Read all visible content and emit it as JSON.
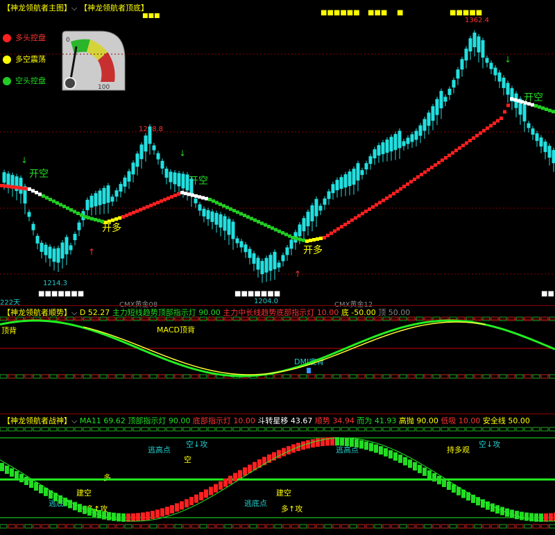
{
  "panel1": {
    "tabs": [
      "【神龙领航者主图】",
      "【神龙领航者顶底】"
    ],
    "top_tags": [
      "■■■■■■",
      "■■■",
      "■",
      "■■■■■"
    ],
    "legend": [
      {
        "label": "多头控盘",
        "color": "#ff2020"
      },
      {
        "label": "多空震荡",
        "color": "#ffff00"
      },
      {
        "label": "空头控盘",
        "color": "#22cc22"
      }
    ],
    "gauge": {
      "min": "0",
      "max": "100",
      "level": 0.12
    },
    "price_labels": {
      "high1": "1298.8",
      "high2": "1362.4",
      "low1": "1214.3",
      "low2": "1204.0"
    },
    "signals": {
      "open_short": "开空",
      "open_long": "开多"
    },
    "bottom_tags": [
      "■■■■■■■",
      "■■■■■■■",
      "■■"
    ],
    "footer": {
      "days": "222天",
      "contract1": "CMX黄金08",
      "contract2": "CMX黄金12"
    }
  },
  "panel2": {
    "title": "【神龙领航者顺势】",
    "indicators": [
      {
        "text": "D 52.27",
        "color": "#ffff00"
      },
      {
        "text": "主力短线趋势顶部指示灯 90.00",
        "color": "#22dd22"
      },
      {
        "text": "主力中长线趋势底部指示灯 10.00",
        "color": "#ff3333"
      },
      {
        "text": "底 -50.00",
        "color": "#ffff00"
      },
      {
        "text": "顶 50.00",
        "color": "#888888"
      }
    ],
    "annotations": {
      "macd_top": "MACD顶背",
      "dmi_bottom": "DMI底背",
      "left_tag": "顶背"
    }
  },
  "panel3": {
    "title": "【神龙领航者战神】",
    "indicators": [
      {
        "text": "MA11 69.62",
        "color": "#22dd22"
      },
      {
        "text": "顶部指示灯 90.00",
        "color": "#22dd22"
      },
      {
        "text": "底部指示灯 10.00",
        "color": "#ff3333"
      },
      {
        "text": "斗转星移 43.67",
        "color": "#ffffff"
      },
      {
        "text": "顺势 34.94",
        "color": "#ff3333"
      },
      {
        "text": "而为 41.93",
        "color": "#22dd22"
      },
      {
        "text": "高抛 90.00",
        "color": "#ffff00"
      },
      {
        "text": "低吸 10.00",
        "color": "#ff3333"
      },
      {
        "text": "安全线 50.00",
        "color": "#ffff00"
      }
    ],
    "annotations": {
      "escape_low": "逃底点",
      "escape_high": "逃高点",
      "long_attack": "多↑攻",
      "short_attack": "空↓攻",
      "buy_short": "建空",
      "many": "多",
      "empty": "空",
      "hold_short": "持多观"
    }
  }
}
